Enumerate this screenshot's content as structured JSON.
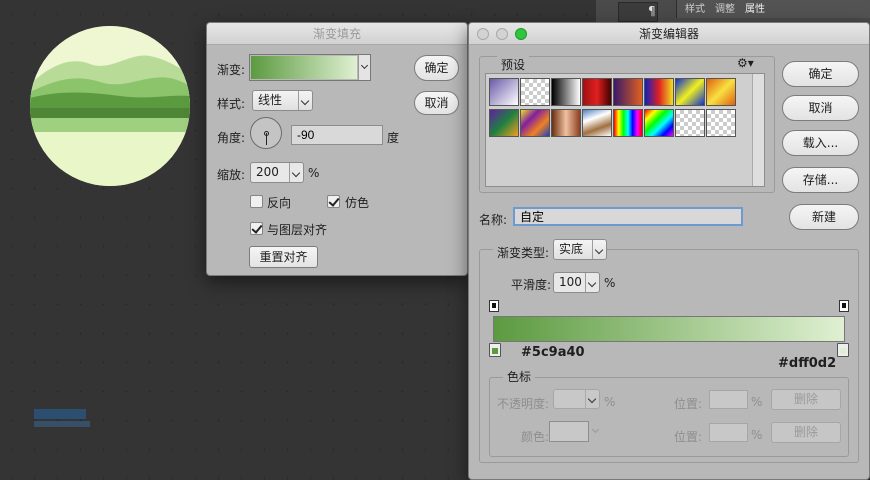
{
  "panel_top": {
    "tabs": [
      "样式",
      "调整",
      "属性"
    ]
  },
  "gradient_fill": {
    "title": "渐变填充",
    "gradient_label": "渐变:",
    "style_label": "样式:",
    "style_value": "线性",
    "angle_label": "角度:",
    "angle_value": "-90",
    "angle_unit": "度",
    "scale_label": "缩放:",
    "scale_value": "200",
    "scale_unit": "%",
    "reverse_label": "反向",
    "reverse_checked": false,
    "dither_label": "仿色",
    "dither_checked": true,
    "align_label": "与图层对齐",
    "align_checked": true,
    "reset_align": "重置对齐",
    "ok": "确定",
    "cancel": "取消",
    "gradient_colors": [
      "#5c9a40",
      "#dff0d2"
    ]
  },
  "gradient_editor": {
    "title": "渐变编辑器",
    "presets_label": "预设",
    "ok": "确定",
    "cancel": "取消",
    "load": "载入...",
    "save": "存储...",
    "name_label": "名称:",
    "name_value": "自定",
    "new_button": "新建",
    "type_label": "渐变类型:",
    "type_value": "实底",
    "smooth_label": "平滑度:",
    "smooth_value": "100",
    "smooth_unit": "%",
    "left_stop_color": "#5c9a40",
    "right_stop_color": "#dff0d2",
    "stops_group_label": "色标",
    "opacity_label": "不透明度:",
    "opacity_unit": "%",
    "location_label": "位置:",
    "location_unit": "%",
    "delete_label": "删除",
    "color_label": "颜色:",
    "presets": [
      {
        "name": "foreground-to-background",
        "css": "linear-gradient(135deg,#6a5aa8,#ffffff)"
      },
      {
        "name": "foreground-to-transparent",
        "css": "checker"
      },
      {
        "name": "black-white",
        "css": "linear-gradient(90deg,#000,#fff)"
      },
      {
        "name": "red-black",
        "css": "linear-gradient(90deg,#a01010,#e02020,#400)"
      },
      {
        "name": "violet-orange",
        "css": "linear-gradient(90deg,#3a1a6a,#e06020)"
      },
      {
        "name": "blue-red-yellow",
        "css": "linear-gradient(90deg,#1020c0,#e02020,#f0e020)"
      },
      {
        "name": "blue-yellow-blue",
        "css": "linear-gradient(135deg,#1030d0,#f0f020,#1030d0)"
      },
      {
        "name": "orange-yellow-orange",
        "css": "linear-gradient(135deg,#e06010,#f8e040,#e06010)"
      },
      {
        "name": "violet-green-orange",
        "css": "linear-gradient(135deg,#6020a0,#208040,#f0a020)"
      },
      {
        "name": "yellow-violet-orange-blue",
        "css": "linear-gradient(135deg,#f0e020,#8020a0,#f08020,#2040c0)"
      },
      {
        "name": "copper",
        "css": "linear-gradient(90deg,#6a3010,#f0c0a0,#8a4020)"
      },
      {
        "name": "chrome",
        "css": "linear-gradient(160deg,#5080c0,#fff,#a07040,#fff)"
      },
      {
        "name": "spectrum",
        "css": "linear-gradient(90deg,#f00,#ff0,#0f0,#0ff,#00f,#f0f,#f00)"
      },
      {
        "name": "transparent-rainbow",
        "css": "linear-gradient(135deg,#f00,#ff0,#0f0,#0ff,#00f,#f0f)"
      },
      {
        "name": "transparent-stripes",
        "css": "checker"
      },
      {
        "name": "neutral-density",
        "css": "checker"
      }
    ]
  }
}
